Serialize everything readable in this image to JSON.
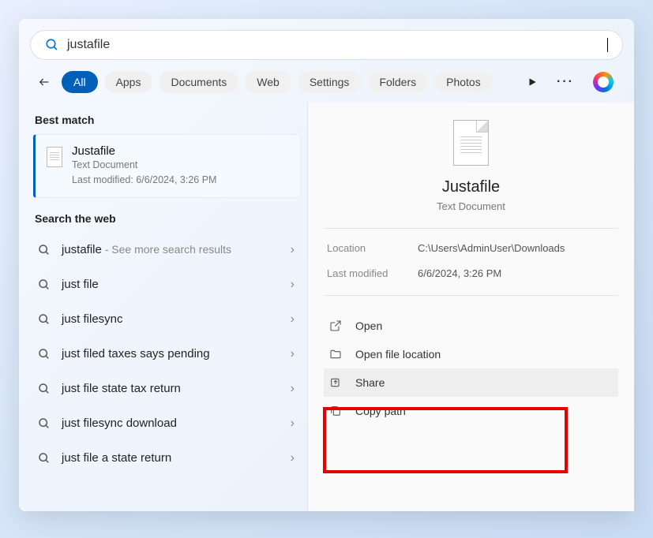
{
  "search": {
    "query": "justafile"
  },
  "filters": {
    "back_aria": "Back",
    "items": [
      {
        "label": "All",
        "active": true
      },
      {
        "label": "Apps",
        "active": false
      },
      {
        "label": "Documents",
        "active": false
      },
      {
        "label": "Web",
        "active": false
      },
      {
        "label": "Settings",
        "active": false
      },
      {
        "label": "Folders",
        "active": false
      },
      {
        "label": "Photos",
        "active": false
      }
    ]
  },
  "sections": {
    "best_match_header": "Best match",
    "search_web_header": "Search the web"
  },
  "best_match": {
    "title": "Justafile",
    "type": "Text Document",
    "modified_line": "Last modified: 6/6/2024, 3:26 PM"
  },
  "web_results": [
    {
      "term": "justafile",
      "suffix": " - See more search results"
    },
    {
      "term": "just file",
      "suffix": ""
    },
    {
      "term": "just filesync",
      "suffix": ""
    },
    {
      "term": "just filed taxes says pending",
      "suffix": ""
    },
    {
      "term": "just file state tax return",
      "suffix": ""
    },
    {
      "term": "just filesync download",
      "suffix": ""
    },
    {
      "term": "just file a state return",
      "suffix": ""
    }
  ],
  "preview": {
    "title": "Justafile",
    "subtitle": "Text Document",
    "meta": [
      {
        "label": "Location",
        "value": "C:\\Users\\AdminUser\\Downloads"
      },
      {
        "label": "Last modified",
        "value": "6/6/2024, 3:26 PM"
      }
    ],
    "actions": [
      {
        "label": "Open",
        "icon": "open"
      },
      {
        "label": "Open file location",
        "icon": "folder"
      },
      {
        "label": "Share",
        "icon": "share",
        "highlighted": true
      },
      {
        "label": "Copy path",
        "icon": "copy"
      }
    ]
  }
}
